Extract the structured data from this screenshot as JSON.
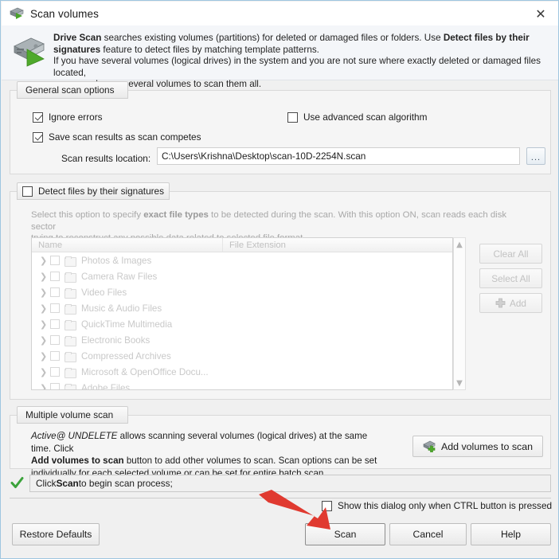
{
  "window": {
    "title": "Scan volumes",
    "icon": "drive-scan-icon",
    "close_label": "✕"
  },
  "header": {
    "icon": "hard-drive-play-icon",
    "line1_a": "Drive Scan",
    "line1_b": " searches existing volumes (partitions) for deleted or damaged files or folders. Use ",
    "line1_c": "Detect files by their",
    "line2_a": "signatures",
    "line2_b": " feature to detect files by matching template patterns.",
    "line3": "If you have several volumes (logical drives) in the system and you are not sure where exactly deleted or damaged files located,",
    "line4": "you may choose several volumes to scan them all."
  },
  "general_scan": {
    "tab_label": "General scan options",
    "ignore_errors": {
      "label": "Ignore errors",
      "checked": true
    },
    "advanced_algorithm": {
      "label": "Use advanced scan algorithm",
      "checked": false
    },
    "save_results": {
      "label": "Save scan results as scan competes",
      "checked": true
    },
    "results_location_label": "Scan results location:",
    "results_location_value": "C:\\Users\\Krishna\\Desktop\\scan-10D-2254N.scan",
    "browse_label": "...",
    "browse_icon": "ellipsis-icon"
  },
  "signatures": {
    "tab_label": "Detect files by their signatures",
    "tab_checked": false,
    "desc_a": "Select this option to specify ",
    "desc_b": "exact file types",
    "desc_c": " to be detected during the scan. With this option ON, scan reads each disk sector",
    "desc_d": "trying to reconstruct any possible data related to selected file format.",
    "columns": [
      "Name",
      "File Extension"
    ],
    "rows": [
      {
        "name": "Photos & Images",
        "extension": "",
        "checked": false,
        "expandable": true
      },
      {
        "name": "Camera Raw Files",
        "extension": "",
        "checked": false,
        "expandable": true
      },
      {
        "name": "Video Files",
        "extension": "",
        "checked": false,
        "expandable": true
      },
      {
        "name": "Music & Audio Files",
        "extension": "",
        "checked": false,
        "expandable": true
      },
      {
        "name": "QuickTime Multimedia",
        "extension": "",
        "checked": false,
        "expandable": true
      },
      {
        "name": "Electronic Books",
        "extension": "",
        "checked": false,
        "expandable": true
      },
      {
        "name": "Compressed Archives",
        "extension": "",
        "checked": false,
        "expandable": true
      },
      {
        "name": "Microsoft & OpenOffice Docu...",
        "extension": "",
        "checked": false,
        "expandable": true
      },
      {
        "name": "Adobe Files",
        "extension": "",
        "checked": false,
        "expandable": true
      }
    ],
    "buttons": {
      "clear_all": "Clear All",
      "select_all": "Select All",
      "add": "Add",
      "add_icon": "plus-icon"
    },
    "scroll_up_icon": "chevron-up-icon",
    "scroll_down_icon": "chevron-down-icon"
  },
  "multiple_volume": {
    "tab_label": "Multiple volume scan",
    "desc_a": "Active@ UNDELETE",
    "desc_b": " allows scanning several volumes (logical drives) at the same time. Click",
    "desc_c": "Add volumes to scan",
    "desc_d": " button to add other volumes to scan. Scan options can be set",
    "desc_e": "individually for each selected volume or can be set for entire batch scan.",
    "add_volumes_label": "Add volumes to scan",
    "add_volumes_icon": "add-volume-icon"
  },
  "status": {
    "icon": "green-check-icon",
    "text_a": "Click ",
    "text_b": "Scan",
    "text_c": " to begin scan process;"
  },
  "footer": {
    "show_dialog_ctrl": {
      "label": "Show this dialog only when CTRL button is pressed",
      "checked": false
    },
    "restore_defaults": "Restore Defaults",
    "scan": "Scan",
    "cancel": "Cancel",
    "help": "Help"
  },
  "annotation": {
    "arrow_icon": "red-arrow-icon",
    "arrow_color": "#e03a30",
    "points_to": "scan-button"
  }
}
